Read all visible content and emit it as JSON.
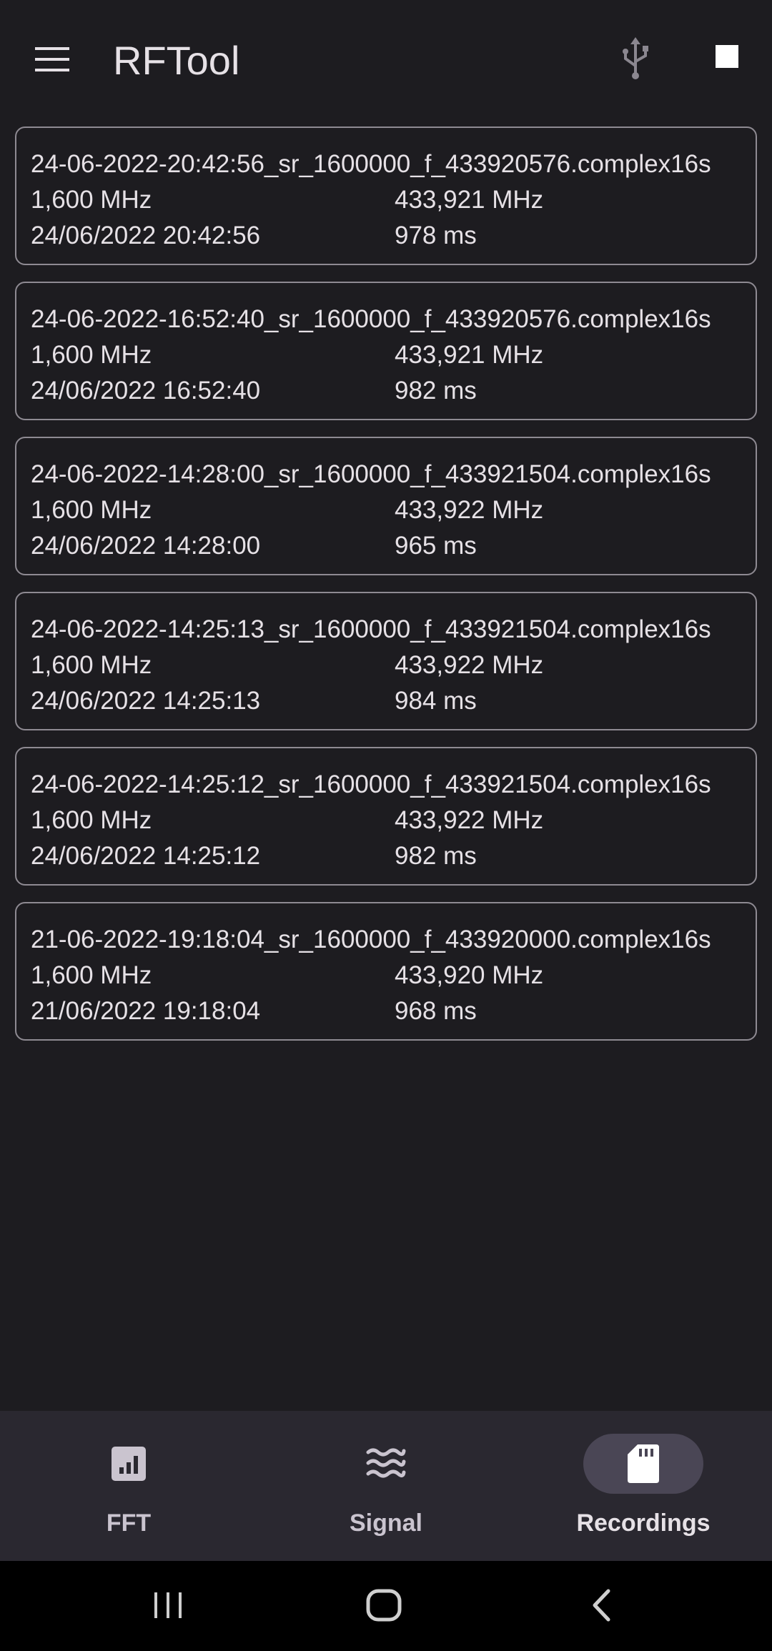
{
  "app": {
    "title": "RFTool"
  },
  "icons": {
    "menu": "hamburger-menu-icon",
    "usb": "usb-icon",
    "stop": "stop-icon",
    "fft": "bar-chart-icon",
    "signal": "waves-icon",
    "recordings": "sd-card-icon"
  },
  "colors": {
    "background": "#1d1c20",
    "card_border": "#8e8a92",
    "nav_background": "#2a2830",
    "active_pill": "#4a4655"
  },
  "recordings": [
    {
      "filename": "24-06-2022-20:42:56_sr_1600000_f_433920576.complex16s",
      "sample_rate": "1,600 MHz",
      "frequency": "433,921 MHz",
      "datetime": "24/06/2022 20:42:56",
      "duration": "978 ms"
    },
    {
      "filename": "24-06-2022-16:52:40_sr_1600000_f_433920576.complex16s",
      "sample_rate": "1,600 MHz",
      "frequency": "433,921 MHz",
      "datetime": "24/06/2022 16:52:40",
      "duration": "982 ms"
    },
    {
      "filename": "24-06-2022-14:28:00_sr_1600000_f_433921504.complex16s",
      "sample_rate": "1,600 MHz",
      "frequency": "433,922 MHz",
      "datetime": "24/06/2022 14:28:00",
      "duration": "965 ms"
    },
    {
      "filename": "24-06-2022-14:25:13_sr_1600000_f_433921504.complex16s",
      "sample_rate": "1,600 MHz",
      "frequency": "433,922 MHz",
      "datetime": "24/06/2022 14:25:13",
      "duration": "984 ms"
    },
    {
      "filename": "24-06-2022-14:25:12_sr_1600000_f_433921504.complex16s",
      "sample_rate": "1,600 MHz",
      "frequency": "433,922 MHz",
      "datetime": "24/06/2022 14:25:12",
      "duration": "982 ms"
    },
    {
      "filename": "21-06-2022-19:18:04_sr_1600000_f_433920000.complex16s",
      "sample_rate": "1,600 MHz",
      "frequency": "433,920 MHz",
      "datetime": "21/06/2022 19:18:04",
      "duration": "968 ms"
    }
  ],
  "bottom_nav": {
    "items": [
      {
        "label": "FFT",
        "icon": "bar-chart-icon",
        "active": false
      },
      {
        "label": "Signal",
        "icon": "waves-icon",
        "active": false
      },
      {
        "label": "Recordings",
        "icon": "sd-card-icon",
        "active": true
      }
    ]
  },
  "system_nav": {
    "buttons": [
      "recent-apps-icon",
      "home-icon",
      "back-icon"
    ]
  }
}
